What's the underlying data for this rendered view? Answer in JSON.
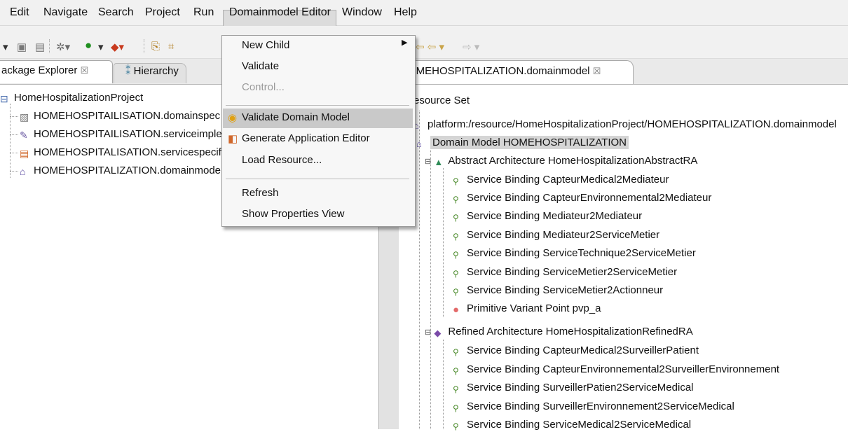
{
  "menubar": {
    "items": [
      "Edit",
      "Navigate",
      "Search",
      "Project",
      "Run",
      "Domainmodel Editor",
      "Window",
      "Help"
    ],
    "open_menu": "Domainmodel Editor"
  },
  "toolbar": {
    "icons": [
      "new-icon",
      "save-icon",
      "print-icon",
      "debug-icon",
      "run-icon",
      "external-tools-icon",
      "open-type-icon",
      "open-task-icon",
      "back-nav-icon",
      "forward-nav-icon"
    ]
  },
  "left_view": {
    "tabs": [
      {
        "label": "ackage Explorer",
        "close": "☒"
      },
      {
        "label": "Hierarchy"
      }
    ],
    "tree": [
      {
        "label": "HomeHospitalizationProject",
        "icon": "project-icon"
      },
      {
        "label": "HOMEHOSPITAILISATION.domainspec",
        "icon": "domainspec-file-icon"
      },
      {
        "label": "HOMEHOSPITAILISATION.serviceimple",
        "icon": "serviceimpl-file-icon"
      },
      {
        "label": "HOMEHOSPITALISATION.servicespecifi",
        "icon": "servicespec-file-icon"
      },
      {
        "label": "HOMEHOSPITALIZATION.domainmode",
        "icon": "domainmodel-file-icon"
      }
    ]
  },
  "editor": {
    "tab_label": "OMEHOSPITALIZATION.domainmodel",
    "tab_close": "☒",
    "tree": {
      "resource_set": "esource Set",
      "resource": "platform:/resource/HomeHospitalizationProject/HOMEHOSPITALIZATION.domainmodel",
      "domain_model": "Domain Model HOMEHOSPITALIZATION",
      "abstract_arch": "Abstract Architecture HomeHospitalizationAbstractRA",
      "abstract_children": [
        "Service Binding CapteurMedical2Mediateur",
        "Service Binding CapteurEnvironnemental2Mediateur",
        "Service Binding Mediateur2Mediateur",
        "Service Binding Mediateur2ServiceMetier",
        "Service Binding ServiceTechnique2ServiceMetier",
        "Service Binding ServiceMetier2ServiceMetier",
        "Service Binding ServiceMetier2Actionneur",
        "Primitive Variant Point pvp_a"
      ],
      "refined_arch": "Refined Architecture HomeHospitalizationRefinedRA",
      "refined_children": [
        "Service Binding CapteurMedical2SurveillerPatient",
        "Service Binding CapteurEnvironnemental2SurveillerEnvironnement",
        "Service Binding SurveillerPatien2ServiceMedical",
        "Service Binding SurveillerEnvironnement2ServiceMedical",
        "Service Binding ServiceMedical2ServiceMedical"
      ]
    }
  },
  "dropdown": {
    "items": [
      {
        "label": "New Child",
        "submenu": true
      },
      {
        "label": "Validate"
      },
      {
        "label": "Control...",
        "disabled": true
      },
      {
        "label": "Validate Domain Model",
        "icon": "validate-icon",
        "highlighted": true
      },
      {
        "label": "Generate Application Editor",
        "icon": "generate-icon"
      },
      {
        "label": "Load Resource..."
      },
      {
        "label": "Refresh"
      },
      {
        "label": "Show Properties View"
      }
    ]
  },
  "colors": {
    "menu_bg": "#f1f1f1",
    "highlight": "#c9c9c9",
    "selection": "#d5d5d5"
  }
}
